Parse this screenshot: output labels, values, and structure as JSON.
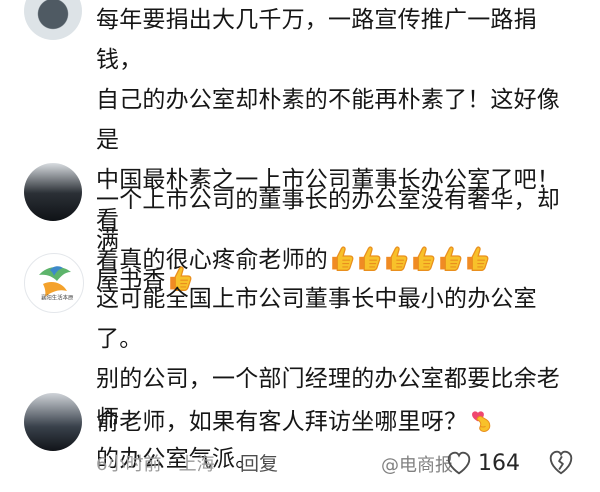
{
  "comments": [
    {
      "text_line1": "每年要捐出大几千万，一路宣传推广一路捐钱，",
      "text_line2": "自己的办公室却朴素的不能再朴素了！这好像是",
      "text_line3": "中国最朴素之一上市公司董事长办公室了吧！看",
      "text_line4": "着真的很心疼俞老师的"
    },
    {
      "text_line1": "一个上市公司的董事长的办公室没有奢华，却满",
      "text_line2": "屋书香"
    },
    {
      "text_line1": "这可能全国上市公司董事长中最小的办公室了。",
      "text_line2": "别的公司，一个部门经理的办公室都要比余老师",
      "text_line3": "的办公室气派。"
    },
    {
      "text_line1": "俞老师，如果有客人拜访坐哪里呀？"
    }
  ],
  "meta": {
    "time_location": "6小时前 · 上海",
    "reply_label": "回复",
    "watermark": "@电商报",
    "like_count": "164"
  },
  "avatar_3_caption": "襄阳生活本原",
  "icons": {
    "like": "thumbs-up-emoji",
    "finger_heart": "finger-heart-emoji",
    "like_button": "heart-outline-icon",
    "dislike_button": "broken-heart-outline-icon"
  },
  "colors": {
    "text_primary": "#161616",
    "meta_text": "#9a9a9a",
    "emoji_yellow": "#f8c12a",
    "emoji_orange": "#f08b24"
  }
}
